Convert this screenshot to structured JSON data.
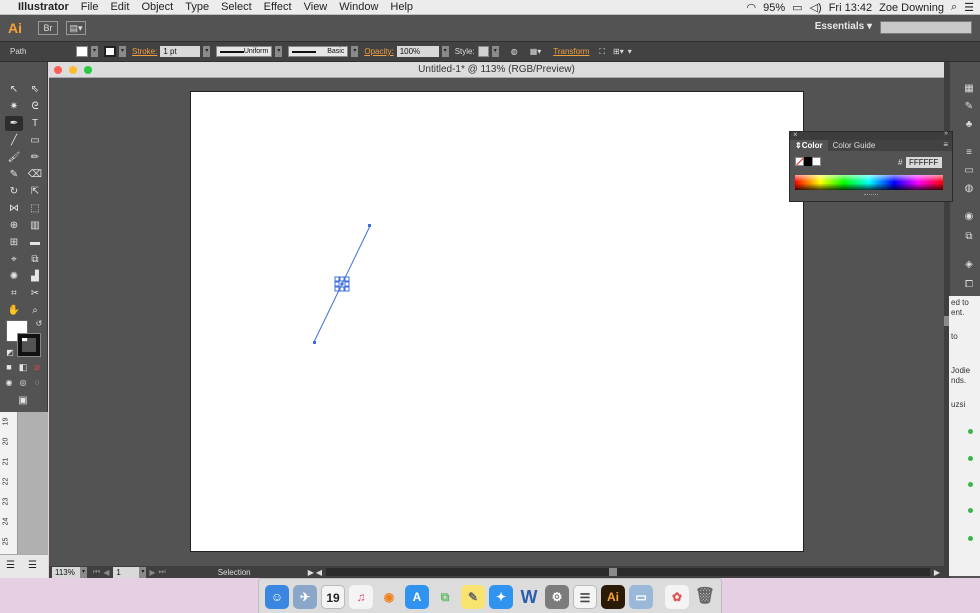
{
  "menubar": {
    "apple": "",
    "app_name": "Illustrator",
    "items": [
      "File",
      "Edit",
      "Object",
      "Type",
      "Select",
      "Effect",
      "View",
      "Window",
      "Help"
    ],
    "battery": "95%",
    "clock": "Fri 13:42",
    "user": "Zoe Downing"
  },
  "appbar": {
    "logo": "Ai",
    "workspace": "Essentials"
  },
  "control_bar": {
    "selection_type": "Path",
    "stroke_label": "Stroke:",
    "stroke_weight": "1 pt",
    "profile": "Uniform",
    "brush": "Basic",
    "opacity_label": "Opacity:",
    "opacity_value": "100%",
    "style_label": "Style:",
    "transform_label": "Transform"
  },
  "document": {
    "title": "Untitled-1* @ 113% (RGB/Preview)"
  },
  "color_panel": {
    "tabs": [
      "Color",
      "Color Guide"
    ],
    "hex_label": "#",
    "hex_value": "FFFFFF"
  },
  "status_bar": {
    "zoom": "113%",
    "artboard_number": "1",
    "tool_name": "Selection"
  },
  "vertical_ruler": {
    "ticks": [
      "19",
      "20",
      "21",
      "22",
      "23",
      "24",
      "25"
    ]
  },
  "right_strip": {
    "lines": [
      "ed to",
      "ent.",
      "to",
      "Jodie",
      "nds.",
      "uzsi"
    ]
  },
  "dock": {
    "calendar_day": "19",
    "illustrator_label": "Ai"
  },
  "colors": {
    "accent_orange": "#f7a233",
    "path_blue": "#3f6fd6",
    "panel_gray": "#535353"
  }
}
